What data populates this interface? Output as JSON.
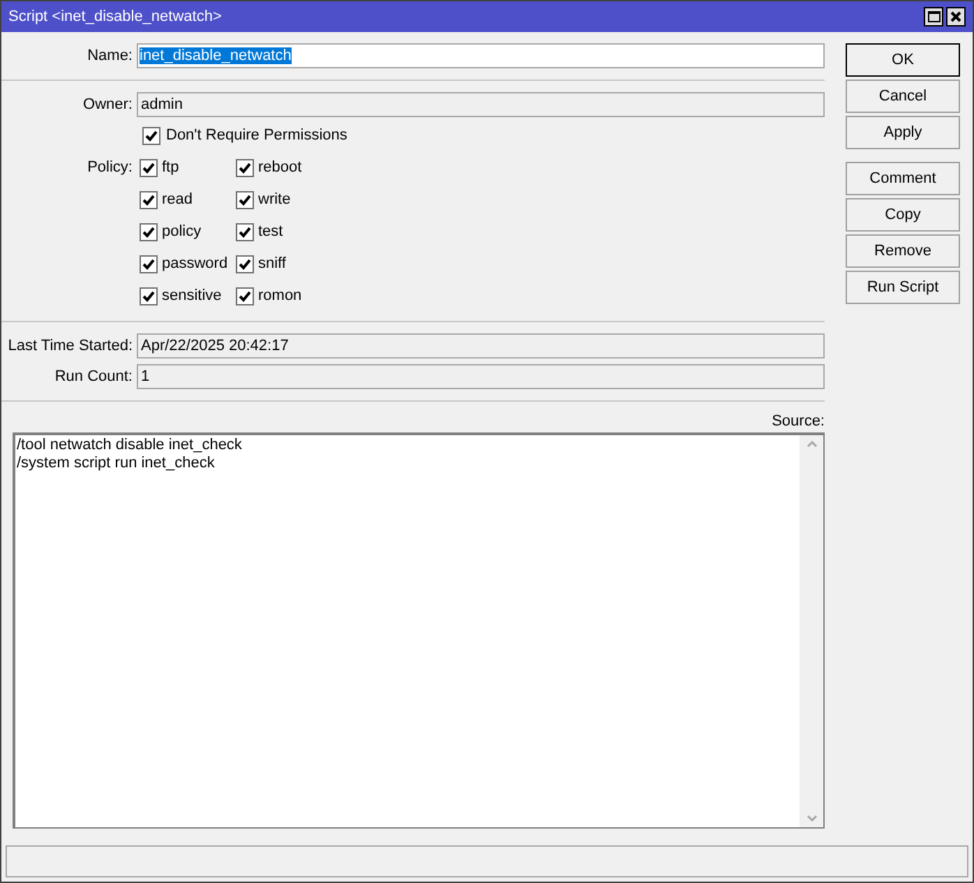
{
  "window": {
    "title": "Script <inet_disable_netwatch>"
  },
  "name": {
    "label": "Name:",
    "value": "inet_disable_netwatch",
    "selected": true
  },
  "owner": {
    "label": "Owner:",
    "value": "admin"
  },
  "dont_require_permissions": {
    "label": "Don't Require Permissions",
    "checked": true
  },
  "policy": {
    "label": "Policy:",
    "items": [
      {
        "label": "ftp",
        "checked": true
      },
      {
        "label": "reboot",
        "checked": true
      },
      {
        "label": "read",
        "checked": true
      },
      {
        "label": "write",
        "checked": true
      },
      {
        "label": "policy",
        "checked": true
      },
      {
        "label": "test",
        "checked": true
      },
      {
        "label": "password",
        "checked": true
      },
      {
        "label": "sniff",
        "checked": true
      },
      {
        "label": "sensitive",
        "checked": true
      },
      {
        "label": "romon",
        "checked": true
      }
    ]
  },
  "last_time_started": {
    "label": "Last Time Started:",
    "value": "Apr/22/2025 20:42:17"
  },
  "run_count": {
    "label": "Run Count:",
    "value": "1"
  },
  "source": {
    "label": "Source:",
    "lines": [
      "/tool netwatch disable inet_check",
      "/system script run inet_check"
    ]
  },
  "dialog_buttons": [
    {
      "label": "OK",
      "default": true
    },
    {
      "label": "Cancel",
      "default": false
    },
    {
      "label": "Apply",
      "default": false
    }
  ],
  "action_buttons": [
    {
      "label": "Comment"
    },
    {
      "label": "Copy"
    },
    {
      "label": "Remove"
    },
    {
      "label": "Run Script"
    }
  ]
}
